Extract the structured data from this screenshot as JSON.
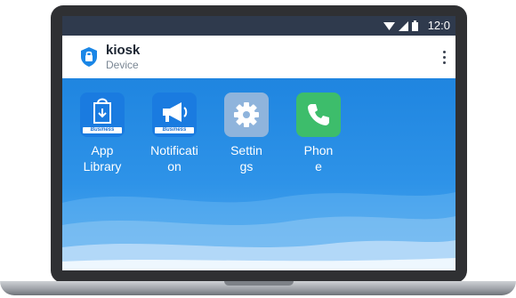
{
  "status_bar": {
    "time": "12:0",
    "icons": [
      "wifi-icon",
      "signal-icon",
      "battery-icon"
    ]
  },
  "header": {
    "title": "kiosk",
    "subtitle": "Device",
    "logo_icon": "shield-lock-icon",
    "menu_icon": "more-vertical-icon"
  },
  "apps": [
    {
      "label_line1": "App",
      "label_line2": "Library",
      "icon": "app-library-icon",
      "badge": "Business",
      "color": "#1a7be0"
    },
    {
      "label_line1": "Notificati",
      "label_line2": "on",
      "icon": "megaphone-icon",
      "badge": "Business",
      "color": "#1a7be0"
    },
    {
      "label_line1": "Settin",
      "label_line2": "gs",
      "icon": "gear-icon",
      "color": "#8fb4dc"
    },
    {
      "label_line1": "Phon",
      "label_line2": "e",
      "icon": "phone-icon",
      "color": "#3dbd6b"
    }
  ],
  "colors": {
    "status_bar": "#2f3a4d",
    "desktop_top": "#1f85e0",
    "desktop_bottom": "#5aaef0"
  }
}
